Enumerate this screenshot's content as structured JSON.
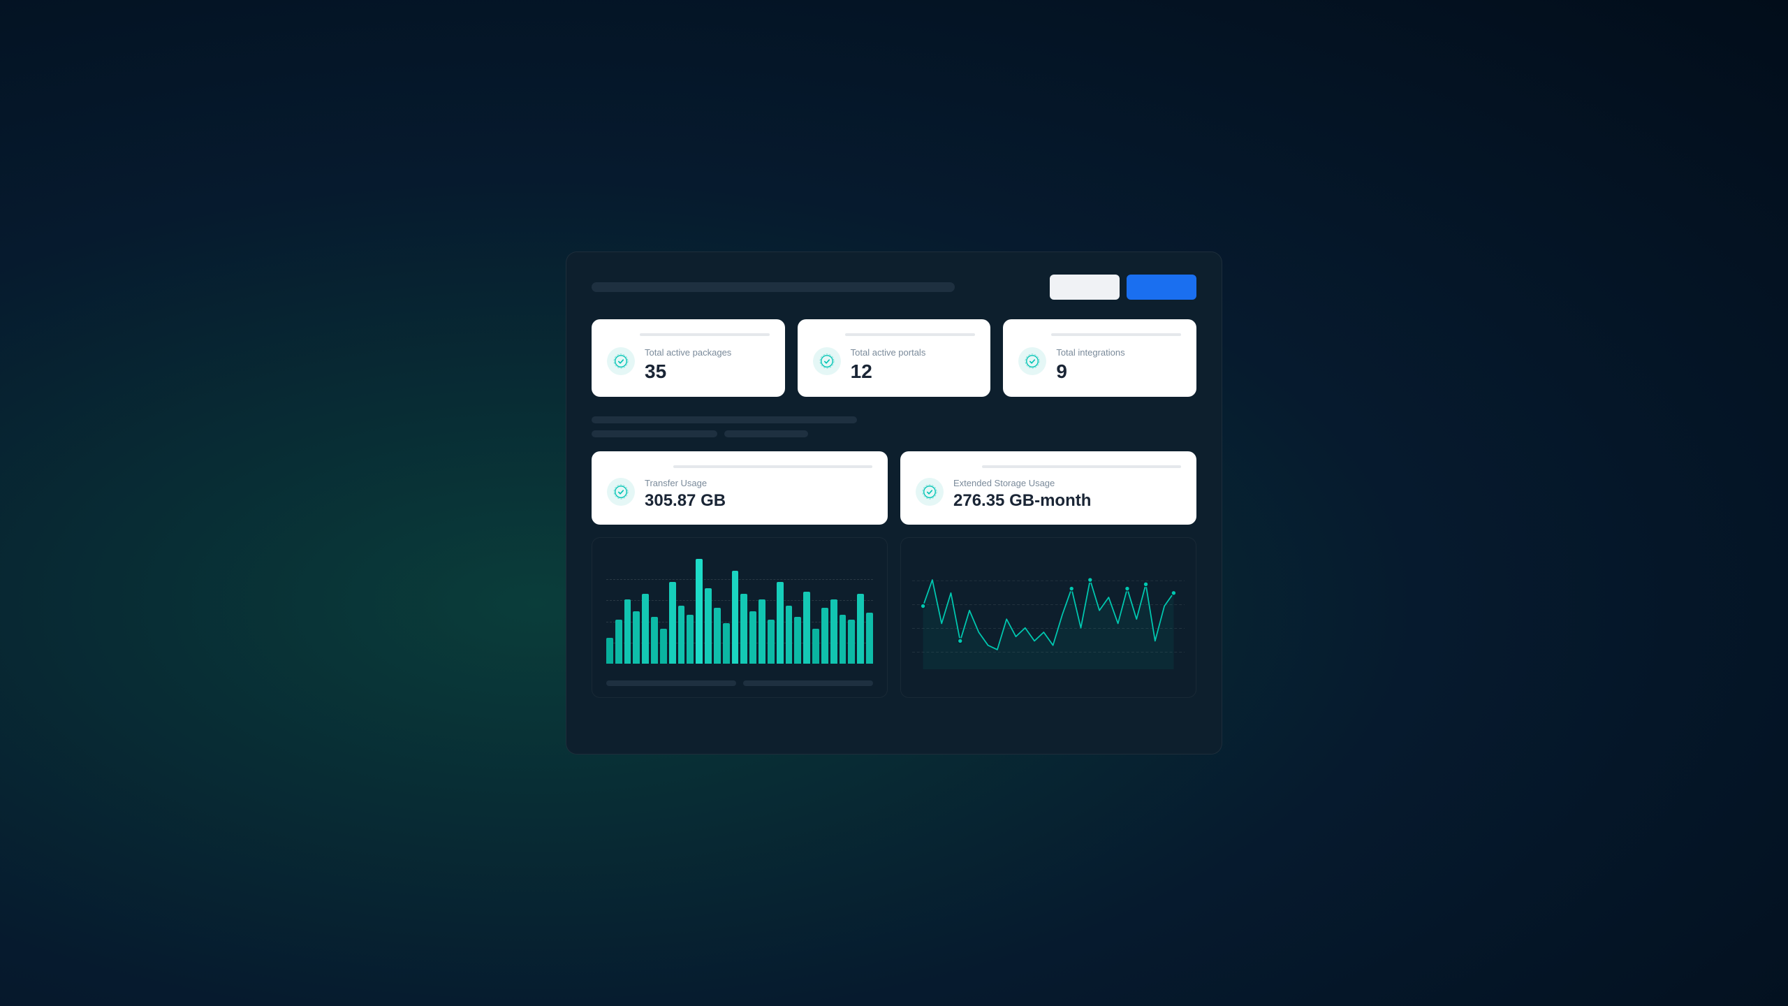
{
  "header": {
    "search_placeholder": "",
    "btn_secondary_label": "",
    "btn_primary_label": ""
  },
  "stats": [
    {
      "label": "Total active packages",
      "value": "35",
      "icon": "badge-check"
    },
    {
      "label": "Total active portals",
      "value": "12",
      "icon": "badge-check"
    },
    {
      "label": "Total integrations",
      "value": "9",
      "icon": "badge-check"
    }
  ],
  "usage": [
    {
      "label": "Transfer Usage",
      "value": "305.87 GB"
    },
    {
      "label": "Extended Storage Usage",
      "value": "276.35 GB-month"
    }
  ],
  "charts": {
    "bar_chart": {
      "bars": [
        22,
        38,
        55,
        45,
        60,
        40,
        30,
        70,
        50,
        42,
        90,
        65,
        48,
        35,
        80,
        60,
        45,
        55,
        38,
        70,
        50,
        40,
        62,
        30,
        48,
        55,
        42,
        38,
        60,
        44
      ]
    },
    "line_chart": {
      "points": [
        {
          "x": 0,
          "y": 60
        },
        {
          "x": 1,
          "y": 90
        },
        {
          "x": 2,
          "y": 40
        },
        {
          "x": 3,
          "y": 75
        },
        {
          "x": 4,
          "y": 20
        },
        {
          "x": 5,
          "y": 55
        },
        {
          "x": 6,
          "y": 30
        },
        {
          "x": 7,
          "y": 15
        },
        {
          "x": 8,
          "y": 10
        },
        {
          "x": 9,
          "y": 45
        },
        {
          "x": 10,
          "y": 25
        },
        {
          "x": 11,
          "y": 35
        },
        {
          "x": 12,
          "y": 20
        },
        {
          "x": 13,
          "y": 30
        },
        {
          "x": 14,
          "y": 15
        },
        {
          "x": 15,
          "y": 50
        },
        {
          "x": 16,
          "y": 80
        },
        {
          "x": 17,
          "y": 35
        },
        {
          "x": 18,
          "y": 90
        },
        {
          "x": 19,
          "y": 55
        },
        {
          "x": 20,
          "y": 70
        },
        {
          "x": 21,
          "y": 40
        },
        {
          "x": 22,
          "y": 80
        },
        {
          "x": 23,
          "y": 45
        },
        {
          "x": 24,
          "y": 85
        },
        {
          "x": 25,
          "y": 20
        },
        {
          "x": 26,
          "y": 60
        },
        {
          "x": 27,
          "y": 75
        }
      ]
    }
  },
  "accent_color": "#00c8b0",
  "bar_color_dark": "#1ec8a0",
  "bar_color_light": "#00e8c0"
}
